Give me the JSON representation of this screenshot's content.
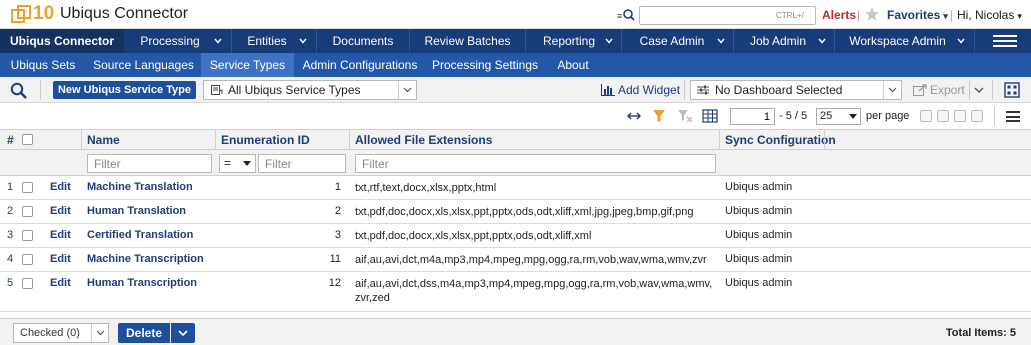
{
  "app": {
    "logo_text": "10",
    "title": "Ubiqus Connector",
    "search_shortcut": "CTRL+/",
    "alerts_label": "Alerts",
    "favorites_label": "Favorites",
    "greeting": "Hi, Nicolas",
    "brand_color": "#173c7a",
    "accent_color": "#c0272d"
  },
  "main_nav": [
    {
      "label": "Ubiqus Connector",
      "active": true
    },
    {
      "label": "Processing"
    },
    {
      "label": "Entities"
    },
    {
      "label": "Documents"
    },
    {
      "label": "Review Batches"
    },
    {
      "label": "Reporting"
    },
    {
      "label": "Case Admin"
    },
    {
      "label": "Job Admin"
    },
    {
      "label": "Workspace Admin"
    }
  ],
  "sub_nav": [
    {
      "label": "Ubiqus Sets"
    },
    {
      "label": "Source Languages"
    },
    {
      "label": "Service Types",
      "active": true
    },
    {
      "label": "Admin Configurations"
    },
    {
      "label": "Processing Settings"
    },
    {
      "label": "About"
    }
  ],
  "toolbar": {
    "new_button": "New Ubiqus Service Type",
    "view_select": "All Ubiqus Service Types",
    "add_widget": "Add Widget",
    "dashboard_select": "No Dashboard Selected",
    "export": "Export"
  },
  "pager": {
    "current_page": "1",
    "page_info": "- 5 / 5",
    "page_size": "25",
    "per_page_label": "per page"
  },
  "grid": {
    "columns": {
      "num": "#",
      "name": "Name",
      "enum": "Enumeration ID",
      "ext": "Allowed File Extensions",
      "sync": "Sync Configuration"
    },
    "filter_placeholder": "Filter",
    "operator": "=",
    "edit_label": "Edit",
    "rows": [
      {
        "num": "1",
        "name": "Machine Translation",
        "enum": "1",
        "ext": "txt,rtf,text,docx,xlsx,pptx,html",
        "sync": "Ubiqus admin"
      },
      {
        "num": "2",
        "name": "Human Translation",
        "enum": "2",
        "ext": "txt,pdf,doc,docx,xls,xlsx,ppt,pptx,ods,odt,xliff,xml,jpg,jpeg,bmp,gif,png",
        "sync": "Ubiqus admin"
      },
      {
        "num": "3",
        "name": "Certified Translation",
        "enum": "3",
        "ext": "txt,pdf,doc,docx,xls,xlsx,ppt,pptx,ods,odt,xliff,xml",
        "sync": "Ubiqus admin"
      },
      {
        "num": "4",
        "name": "Machine Transcription",
        "enum": "11",
        "ext": "aif,au,avi,dct,m4a,mp3,mp4,mpeg,mpg,ogg,ra,rm,vob,wav,wma,wmv,zvr",
        "sync": "Ubiqus admin"
      },
      {
        "num": "5",
        "name": "Human Transcription",
        "enum": "12",
        "ext": "aif,au,avi,dct,dss,m4a,mp3,mp4,mpeg,mpg,ogg,ra,rm,vob,wav,wma,wmv,zvr,zed",
        "sync": "Ubiqus admin"
      }
    ]
  },
  "footer": {
    "checked_select": "Checked (0)",
    "delete_button": "Delete",
    "total_items": "Total Items: 5"
  }
}
